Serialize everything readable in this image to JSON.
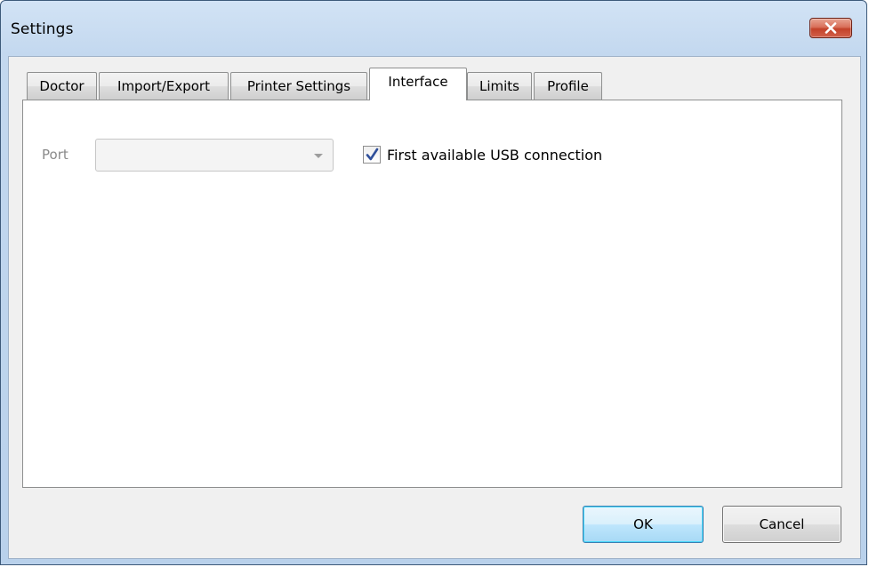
{
  "window": {
    "title": "Settings",
    "close_icon": "close-x-icon"
  },
  "tabs": [
    {
      "label": "Doctor",
      "active": false
    },
    {
      "label": "Import/Export",
      "active": false
    },
    {
      "label": "Printer Settings",
      "active": false
    },
    {
      "label": "Interface",
      "active": true
    },
    {
      "label": "Limits",
      "active": false
    },
    {
      "label": "Profile",
      "active": false
    }
  ],
  "interface": {
    "port_label": "Port",
    "port_value": "",
    "port_enabled": false,
    "usb_checkbox_label": "First available USB connection",
    "usb_checked": true
  },
  "buttons": {
    "ok_label": "OK",
    "cancel_label": "Cancel"
  },
  "colors": {
    "title_bar": "#c3d8ef",
    "close_button": "#c3422a",
    "default_button_border": "#3c7fb1",
    "checkmark": "#2f4f9a"
  }
}
